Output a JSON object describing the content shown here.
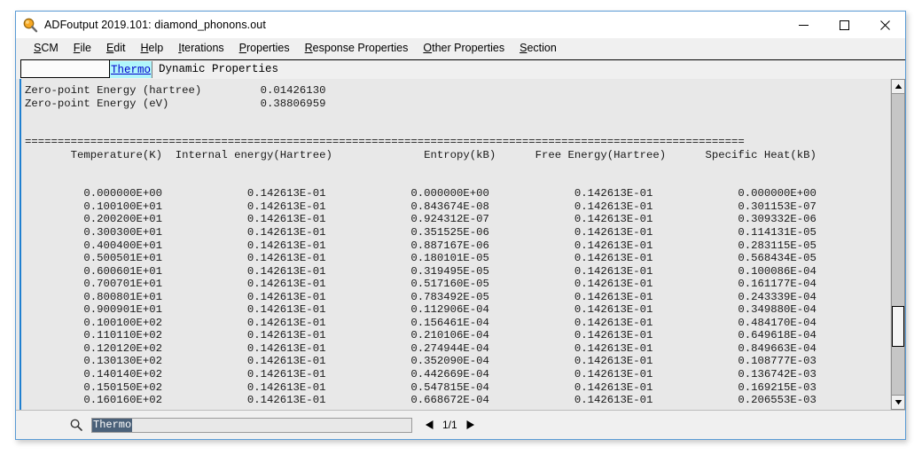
{
  "window": {
    "title": "ADFoutput 2019.101: diamond_phonons.out",
    "icon": "magnifier-icon",
    "controls": {
      "minimize": "minimize-icon",
      "maximize": "maximize-icon",
      "close": "close-icon"
    }
  },
  "menubar": [
    {
      "label": "SCM",
      "mnemonic": "S",
      "rest": "CM"
    },
    {
      "label": "File",
      "mnemonic": "F",
      "rest": "ile"
    },
    {
      "label": "Edit",
      "mnemonic": "E",
      "rest": "dit"
    },
    {
      "label": "Help",
      "mnemonic": "H",
      "rest": "elp"
    },
    {
      "label": "Iterations",
      "mnemonic": "I",
      "rest": "terations"
    },
    {
      "label": "Properties",
      "mnemonic": "P",
      "rest": "roperties"
    },
    {
      "label": "Response Properties",
      "mnemonic": "R",
      "rest": "esponse Properties"
    },
    {
      "label": "Other Properties",
      "mnemonic": "O",
      "rest": "ther Properties"
    },
    {
      "label": "Section",
      "mnemonic": "S",
      "rest": "ection"
    }
  ],
  "tabstrip": {
    "blank_field_value": "",
    "active_tab": "Thermo",
    "next_tab": "Dynamic Properties"
  },
  "content": {
    "zero_point": [
      {
        "label": "Zero-point Energy (hartree)",
        "value": "0.01426130"
      },
      {
        "label": "Zero-point Energy (eV)",
        "value": "0.38806959"
      }
    ],
    "separator": "================================================================================================================================",
    "table_headers": [
      "Temperature(K)",
      "Internal energy(Hartree)",
      "Entropy(kB)",
      "Free Energy(Hartree)",
      "Specific Heat(kB)"
    ],
    "text_block": "Zero-point Energy (hartree)         0.01426130\nZero-point Energy (eV)              0.38806959\n\n\n==============================================================================================================\n       Temperature(K)  Internal energy(Hartree)              Entropy(kB)      Free Energy(Hartree)      Specific Heat(kB)\n\n\n         0.000000E+00             0.142613E-01             0.000000E+00             0.142613E-01             0.000000E+00\n         0.100100E+01             0.142613E-01             0.843674E-08             0.142613E-01             0.301153E-07\n         0.200200E+01             0.142613E-01             0.924312E-07             0.142613E-01             0.309332E-06\n         0.300300E+01             0.142613E-01             0.351525E-06             0.142613E-01             0.114131E-05\n         0.400400E+01             0.142613E-01             0.887167E-06             0.142613E-01             0.283115E-05\n         0.500501E+01             0.142613E-01             0.180101E-05             0.142613E-01             0.568434E-05\n         0.600601E+01             0.142613E-01             0.319495E-05             0.142613E-01             0.100086E-04\n         0.700701E+01             0.142613E-01             0.517160E-05             0.142613E-01             0.161177E-04\n         0.800801E+01             0.142613E-01             0.783492E-05             0.142613E-01             0.243339E-04\n         0.900901E+01             0.142613E-01             0.112906E-04             0.142613E-01             0.349880E-04\n         0.100100E+02             0.142613E-01             0.156461E-04             0.142613E-01             0.484170E-04\n         0.110110E+02             0.142613E-01             0.210106E-04             0.142613E-01             0.649618E-04\n         0.120120E+02             0.142613E-01             0.274944E-04             0.142613E-01             0.849663E-04\n         0.130130E+02             0.142613E-01             0.352090E-04             0.142613E-01             0.108777E-03\n         0.140140E+02             0.142613E-01             0.442669E-04             0.142613E-01             0.136742E-03\n         0.150150E+02             0.142613E-01             0.547815E-04             0.142613E-01             0.169215E-03\n         0.160160E+02             0.142613E-01             0.668672E-04             0.142613E-01             0.206553E-03",
    "rows": [
      [
        "0.000000E+00",
        "0.142613E-01",
        "0.000000E+00",
        "0.142613E-01",
        "0.000000E+00"
      ],
      [
        "0.100100E+01",
        "0.142613E-01",
        "0.843674E-08",
        "0.142613E-01",
        "0.301153E-07"
      ],
      [
        "0.200200E+01",
        "0.142613E-01",
        "0.924312E-07",
        "0.142613E-01",
        "0.309332E-06"
      ],
      [
        "0.300300E+01",
        "0.142613E-01",
        "0.351525E-06",
        "0.142613E-01",
        "0.114131E-05"
      ],
      [
        "0.400400E+01",
        "0.142613E-01",
        "0.887167E-06",
        "0.142613E-01",
        "0.283115E-05"
      ],
      [
        "0.500501E+01",
        "0.142613E-01",
        "0.180101E-05",
        "0.142613E-01",
        "0.568434E-05"
      ],
      [
        "0.600601E+01",
        "0.142613E-01",
        "0.319495E-05",
        "0.142613E-01",
        "0.100086E-04"
      ],
      [
        "0.700701E+01",
        "0.142613E-01",
        "0.517160E-05",
        "0.142613E-01",
        "0.161177E-04"
      ],
      [
        "0.800801E+01",
        "0.142613E-01",
        "0.783492E-05",
        "0.142613E-01",
        "0.243339E-04"
      ],
      [
        "0.900901E+01",
        "0.142613E-01",
        "0.112906E-04",
        "0.142613E-01",
        "0.349880E-04"
      ],
      [
        "0.100100E+02",
        "0.142613E-01",
        "0.156461E-04",
        "0.142613E-01",
        "0.484170E-04"
      ],
      [
        "0.110110E+02",
        "0.142613E-01",
        "0.210106E-04",
        "0.142613E-01",
        "0.649618E-04"
      ],
      [
        "0.120120E+02",
        "0.142613E-01",
        "0.274944E-04",
        "0.142613E-01",
        "0.849663E-04"
      ],
      [
        "0.130130E+02",
        "0.142613E-01",
        "0.352090E-04",
        "0.142613E-01",
        "0.108777E-03"
      ],
      [
        "0.140140E+02",
        "0.142613E-01",
        "0.442669E-04",
        "0.142613E-01",
        "0.136742E-03"
      ],
      [
        "0.150150E+02",
        "0.142613E-01",
        "0.547815E-04",
        "0.142613E-01",
        "0.169215E-03"
      ],
      [
        "0.160160E+02",
        "0.142613E-01",
        "0.668672E-04",
        "0.142613E-01",
        "0.206553E-03"
      ]
    ]
  },
  "searchbar": {
    "icon": "search-icon",
    "value": "Thermo",
    "placeholder": "",
    "prev_icon": "triangle-left-icon",
    "next_icon": "triangle-right-icon",
    "page_count": "1/1"
  },
  "scrollbar": {
    "up_icon": "triangle-up-icon",
    "down_icon": "triangle-down-icon"
  },
  "colors": {
    "window_border": "#5a9bd5",
    "chrome": "#f0f0f0",
    "content_bg": "#e8e8e8",
    "tab_highlight": "#b0f5fb",
    "tab_link": "#0000cc",
    "selection": "#4b6179",
    "caret": "#1f7fd0"
  }
}
